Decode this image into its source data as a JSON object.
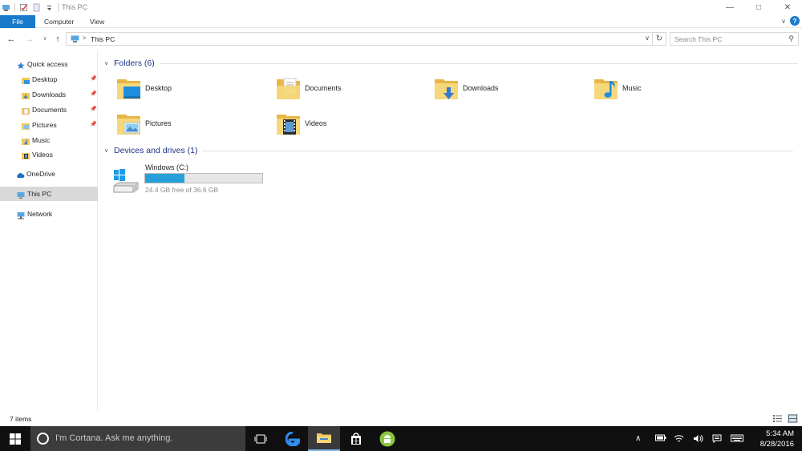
{
  "window": {
    "title": "This PC",
    "minimize_glyph": "—",
    "maximize_glyph": "□",
    "close_glyph": "✕"
  },
  "ribbon": {
    "tabs": [
      {
        "label": "File",
        "active": true
      },
      {
        "label": "Computer",
        "active": false
      },
      {
        "label": "View",
        "active": false
      }
    ],
    "help_glyph": "?",
    "expand_glyph": "∨"
  },
  "address": {
    "back_glyph": "←",
    "forward_glyph": "→",
    "recent_glyph": "∨",
    "up_glyph": "↑",
    "separator": ">",
    "current": "This PC",
    "dropdown_glyph": "∨",
    "refresh_glyph": "↻",
    "search_placeholder": "Search This PC",
    "search_glyph": "⚲"
  },
  "nav": {
    "items": [
      {
        "label": "Quick access",
        "icon": "star-icon",
        "pinned": false
      },
      {
        "label": "Desktop",
        "icon": "desktop-folder-icon",
        "pinned": true
      },
      {
        "label": "Downloads",
        "icon": "downloads-folder-icon",
        "pinned": true
      },
      {
        "label": "Documents",
        "icon": "documents-folder-icon",
        "pinned": true
      },
      {
        "label": "Pictures",
        "icon": "pictures-folder-icon",
        "pinned": true
      },
      {
        "label": "Music",
        "icon": "music-folder-icon",
        "pinned": false
      },
      {
        "label": "Videos",
        "icon": "videos-folder-icon",
        "pinned": false
      },
      {
        "label": "OneDrive",
        "icon": "cloud-icon",
        "pinned": false
      },
      {
        "label": "This PC",
        "icon": "computer-icon",
        "pinned": false,
        "selected": true
      },
      {
        "label": "Network",
        "icon": "network-icon",
        "pinned": false
      }
    ],
    "pin_glyph": "📌"
  },
  "content": {
    "folders_heading": "Folders (6)",
    "folders": [
      {
        "name": "Desktop",
        "icon": "desktop-folder-icon"
      },
      {
        "name": "Documents",
        "icon": "documents-folder-icon"
      },
      {
        "name": "Downloads",
        "icon": "downloads-folder-icon"
      },
      {
        "name": "Music",
        "icon": "music-folder-icon"
      },
      {
        "name": "Pictures",
        "icon": "pictures-folder-icon"
      },
      {
        "name": "Videos",
        "icon": "videos-folder-icon"
      }
    ],
    "devices_heading": "Devices and drives (1)",
    "drive": {
      "name": "Windows (C:)",
      "free_text": "24.4 GB free of 36.6 GB",
      "used_fraction": 0.333,
      "bar_color": "#26a0da"
    }
  },
  "status": {
    "items_count": "7 items"
  },
  "taskbar": {
    "cortana_text": "I'm Cortana. Ask me anything.",
    "time": "5:34 AM",
    "date": "8/28/2016",
    "apps": [
      "task-view-icon",
      "edge-icon",
      "file-explorer-icon",
      "store-icon",
      "android-icon"
    ],
    "tray": [
      "chevron-up-icon",
      "battery-icon",
      "wifi-icon",
      "volume-icon",
      "notification-icon",
      "keyboard-icon"
    ]
  },
  "colors": {
    "accent": "#1979ca",
    "heading": "#1e3287",
    "folder": "#f2c75c",
    "taskbar": "#101010"
  }
}
